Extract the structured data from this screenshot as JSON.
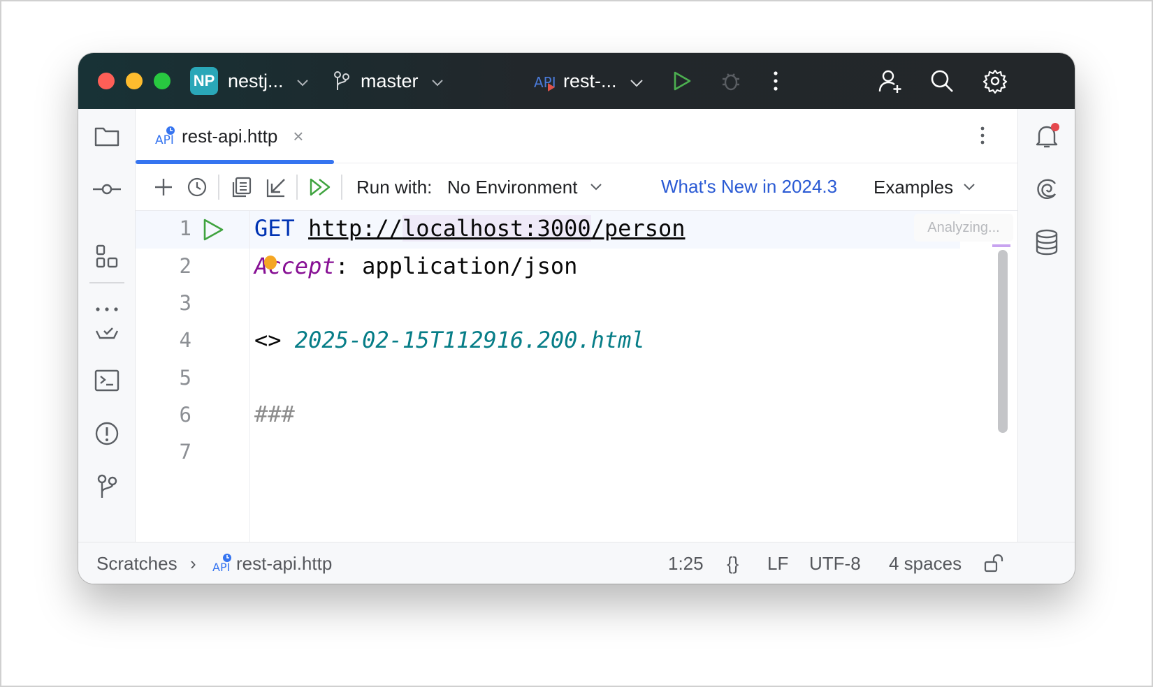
{
  "titlebar": {
    "project_badge": "NP",
    "project_name": "nestj...",
    "branch": "master",
    "run_config": "rest-...",
    "icons": [
      "chevron-down-icon",
      "branch-icon",
      "api-icon",
      "run-icon",
      "debug-icon",
      "more-icon",
      "add-user-icon",
      "search-icon",
      "gear-icon"
    ]
  },
  "left_tools": [
    "folder-icon",
    "commit-icon",
    "structure-icon",
    "more-horizontal-icon",
    "services-icon",
    "terminal-icon",
    "problems-icon",
    "git-icon"
  ],
  "right_tools": [
    "notifications-icon",
    "ai-assistant-icon",
    "database-icon"
  ],
  "tab": {
    "label": "rest-api.http",
    "close": "×"
  },
  "toolbar": {
    "run_with_label": "Run with:",
    "environment": "No Environment",
    "whats_new": "What's New in 2024.3",
    "examples": "Examples"
  },
  "editor": {
    "line_numbers": [
      "1",
      "2",
      "3",
      "4",
      "5",
      "6",
      "7"
    ],
    "lines": {
      "l1_method": "GET",
      "l1_url_a": "http://",
      "l1_url_b": "localhost:3000",
      "l1_url_c": "/person",
      "l2_header": "Accept",
      "l2_rest": ": application/json",
      "l4_prefix": "<> ",
      "l4_file": "2025-02-15T112916.200.html",
      "l6_comment": "###"
    },
    "analyzing": "Analyzing..."
  },
  "statusbar": {
    "breadcrumb_root": "Scratches",
    "breadcrumb_sep": "›",
    "breadcrumb_file": "rest-api.http",
    "position": "1:25",
    "braces": "{}",
    "line_ending": "LF",
    "encoding": "UTF-8",
    "indent": "4 spaces"
  },
  "colors": {
    "accent": "#3574f0",
    "titlebar": "#23272a",
    "link": "#2a5ad4",
    "run_green": "#3fa33f"
  }
}
